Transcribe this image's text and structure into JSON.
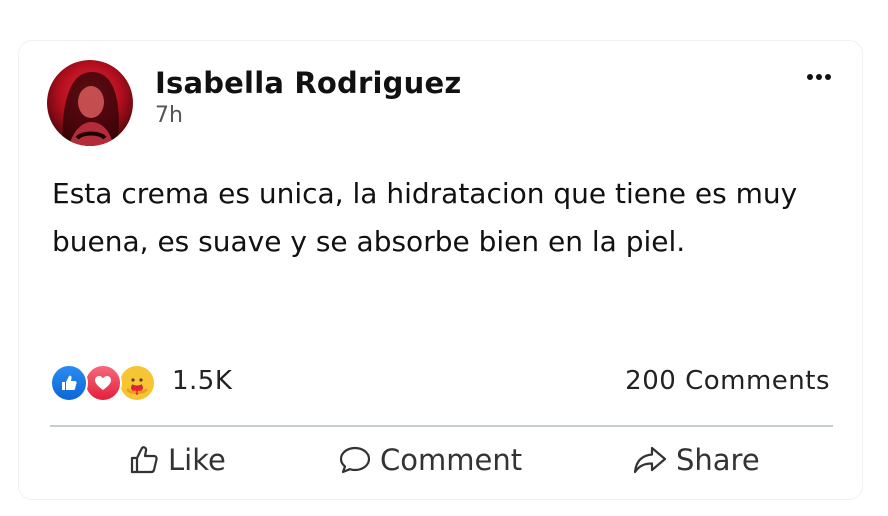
{
  "post": {
    "author_name": "Isabella Rodriguez",
    "timestamp": "7h",
    "text": "Esta crema es unica, la hidratacion que tiene es muy buena, es suave y se absorbe bien en la piel.",
    "reaction_icons": [
      "like-icon",
      "love-icon",
      "care-icon"
    ],
    "reaction_count": "1.5K",
    "comments_count": "200 Comments"
  },
  "actions": {
    "like_label": "Like",
    "comment_label": "Comment",
    "share_label": "Share"
  },
  "colors": {
    "like_blue": "#1877F2",
    "love_red": "#E41E3F",
    "care_yellow": "#F7C533",
    "divider": "#C5CDD8"
  }
}
